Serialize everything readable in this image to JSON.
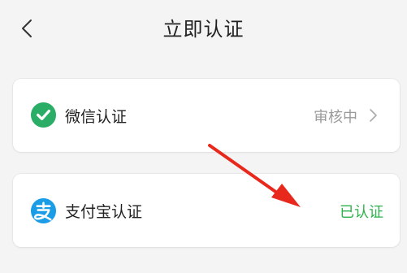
{
  "header": {
    "title": "立即认证",
    "back_icon": "back-chevron-icon"
  },
  "items": [
    {
      "label": "微信认证",
      "status": "审核中",
      "icon": "wechat-icon",
      "status_color": "#9a9a9a"
    },
    {
      "label": "支付宝认证",
      "status": "已认证",
      "icon": "alipay-icon",
      "status_color": "#2bb24c"
    }
  ],
  "colors": {
    "wechat": "#2aae67",
    "alipay": "#1a9de6",
    "annotation": "#e8281c"
  }
}
